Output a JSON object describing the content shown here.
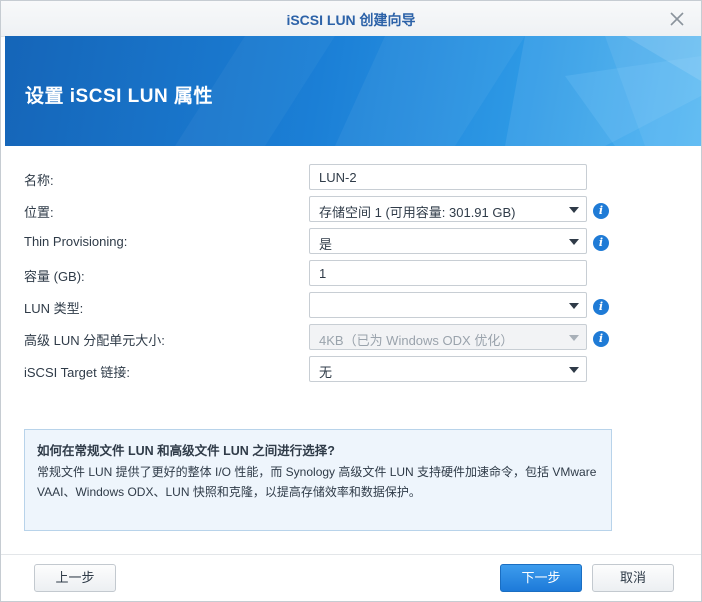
{
  "window": {
    "title": "iSCSI LUN 创建向导",
    "banner_title": "设置 iSCSI LUN 属性"
  },
  "form": {
    "name": {
      "label": "名称:",
      "value": "LUN-2"
    },
    "location": {
      "label": "位置:",
      "value": "存储空间 1 (可用容量: 301.91 GB)"
    },
    "thin_provisioning": {
      "label": "Thin Provisioning:",
      "value": "是"
    },
    "capacity": {
      "label": "容量 (GB):",
      "value": "1"
    },
    "lun_type": {
      "label": "LUN 类型:",
      "value": ""
    },
    "advanced_lun_unit": {
      "label": "高级 LUN 分配单元大小:",
      "value": "4KB（已为 Windows ODX 优化）"
    },
    "iscsi_target": {
      "label": "iSCSI Target 链接:",
      "value": "无"
    }
  },
  "help": {
    "title": "如何在常规文件 LUN 和高级文件 LUN 之间进行选择?",
    "body": "常规文件 LUN 提供了更好的整体 I/O 性能，而 Synology 高级文件 LUN 支持硬件加速命令，包括 VMware VAAI、Windows ODX、LUN 快照和克隆，以提高存储效率和数据保护。"
  },
  "buttons": {
    "back": "上一步",
    "next": "下一步",
    "cancel": "取消"
  },
  "icons": {
    "close": "close-icon",
    "info": "info-icon",
    "dropdown": "chevron-down-icon"
  },
  "colors": {
    "accent": "#1f7bd6",
    "title": "#2c62a8",
    "banner": "#1b7fd6"
  }
}
